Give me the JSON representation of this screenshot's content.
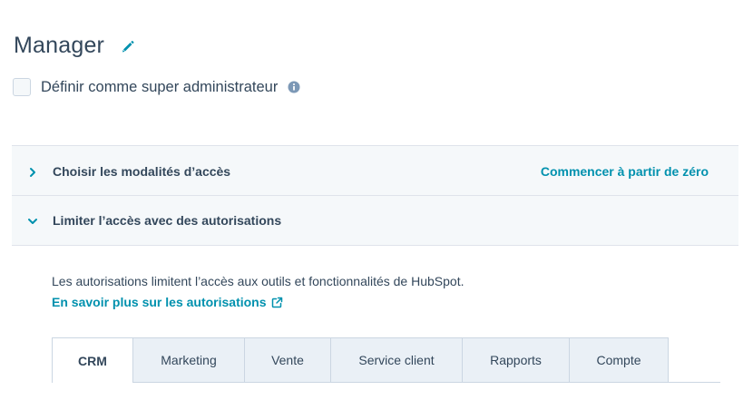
{
  "header": {
    "title": "Manager",
    "edit_icon": "pencil-icon"
  },
  "super_admin": {
    "checked": false,
    "label": "Définir comme super administrateur",
    "info_icon": "info-icon"
  },
  "accordions": [
    {
      "title": "Choisir les modalités d’accès",
      "expanded": false,
      "action_label": "Commencer à partir de zéro"
    },
    {
      "title": "Limiter l’accès avec des autorisations",
      "expanded": true
    }
  ],
  "permissions": {
    "description": "Les autorisations limitent l’accès aux outils et fonctionnalités de HubSpot.",
    "learn_more_label": "En savoir plus sur les autorisations",
    "learn_more_icon": "external-link-icon"
  },
  "tabs": [
    {
      "label": "CRM",
      "active": true
    },
    {
      "label": "Marketing",
      "active": false
    },
    {
      "label": "Vente",
      "active": false
    },
    {
      "label": "Service client",
      "active": false
    },
    {
      "label": "Rapports",
      "active": false
    },
    {
      "label": "Compte",
      "active": false
    }
  ],
  "colors": {
    "text": "#33475b",
    "link": "#0091ae",
    "panel_bg": "#f5f8fa",
    "tab_bg": "#eaf0f6",
    "border": "#cbd6e2"
  }
}
